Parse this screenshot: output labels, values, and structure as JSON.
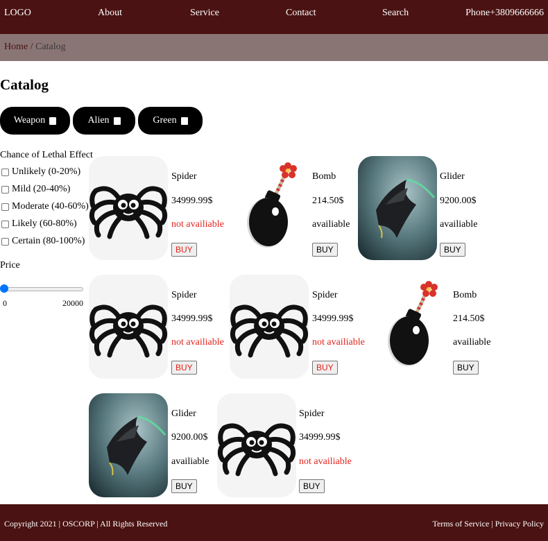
{
  "header": {
    "logo": "LOGO",
    "nav": [
      "About",
      "Service",
      "Contact",
      "Search"
    ],
    "phone": "Phone+3809666666"
  },
  "breadcrumb": {
    "home": "Home",
    "separator": "/",
    "current": "Catalog"
  },
  "page_title": "Catalog",
  "filters": {
    "pills": [
      "Weapon",
      "Alien",
      "Green"
    ],
    "lethal_heading": "Chance of Lethal Effect",
    "lethal_options": [
      "Unlikely (0-20%)",
      "Mild (20-40%)",
      "Moderate (40-60%)",
      "Likely (60-80%)",
      "Certain (80-100%)"
    ],
    "price_heading": "Price",
    "price_min": "0",
    "price_max": "20000"
  },
  "products": [
    {
      "name": "Spider",
      "price": "34999.99$",
      "status": "not availiable",
      "image": "spider-icon",
      "buy": "BUY"
    },
    {
      "name": "Bomb",
      "price": "214.50$",
      "status": "availiable",
      "image": "bomb-icon",
      "buy": "BUY"
    },
    {
      "name": "Glider",
      "price": "9200.00$",
      "status": "availiable",
      "image": "glider-image",
      "buy": "BUY"
    },
    {
      "name": "Spider",
      "price": "34999.99$",
      "status": "not availiable",
      "image": "spider-icon",
      "buy": "BUY"
    },
    {
      "name": "Spider",
      "price": "34999.99$",
      "status": "not availiable",
      "image": "spider-icon",
      "buy": "BUY"
    },
    {
      "name": "Bomb",
      "price": "214.50$",
      "status": "availiable",
      "image": "bomb-icon",
      "buy": "BUY"
    },
    {
      "name": "Glider",
      "price": "9200.00$",
      "status": "availiable",
      "image": "glider-image",
      "buy": "BUY"
    },
    {
      "name": "Spider",
      "price": "34999.99$",
      "status": "not availiable",
      "image": "spider-icon",
      "buy": "BUY"
    }
  ],
  "footer": {
    "copyright": "Copyright 2021 | OSCORP | All Rights Reserved",
    "terms": "Terms of Service",
    "separator": "|",
    "privacy": "Privacy Policy"
  },
  "colors": {
    "header_bg": "#4a1212",
    "breadcrumb_bg": "#8a7575",
    "unavailable": "#e0231c",
    "slider_thumb": "#0075ff"
  }
}
